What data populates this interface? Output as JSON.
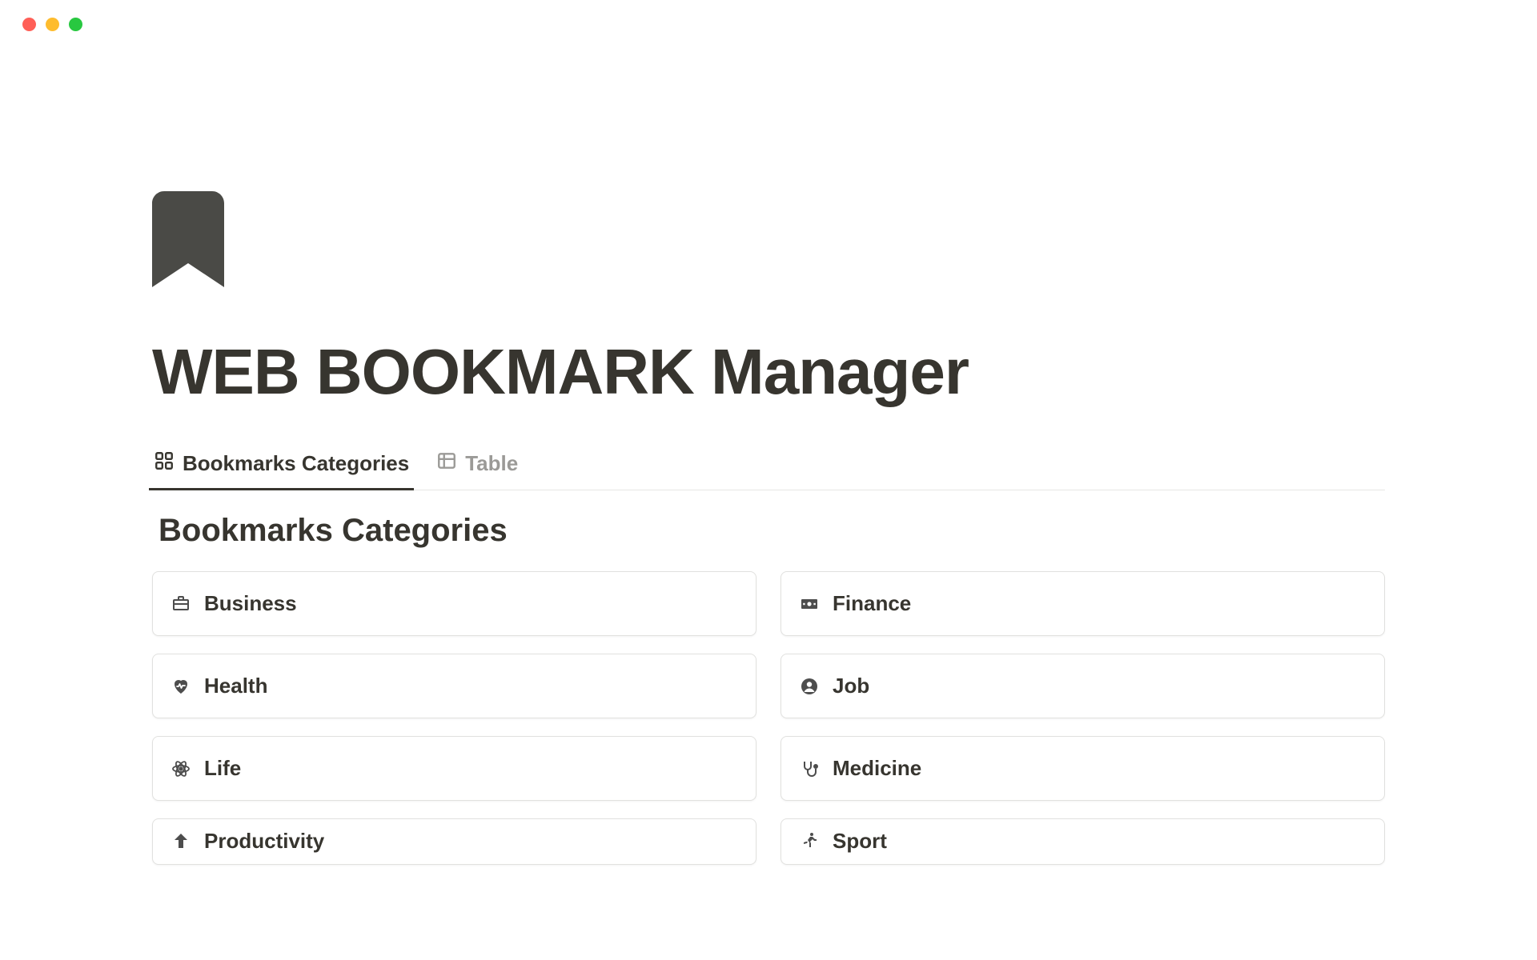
{
  "page": {
    "title": "WEB BOOKMARK Manager",
    "hero_icon": "bookmark-icon"
  },
  "tabs": [
    {
      "label": "Bookmarks Categories",
      "icon": "gallery-icon",
      "active": true
    },
    {
      "label": "Table",
      "icon": "table-icon",
      "active": false
    }
  ],
  "section": {
    "title": "Bookmarks Categories"
  },
  "categories": [
    {
      "label": "Business",
      "icon": "briefcase-icon"
    },
    {
      "label": "Finance",
      "icon": "banknote-icon"
    },
    {
      "label": "Health",
      "icon": "heartbeat-icon"
    },
    {
      "label": "Job",
      "icon": "user-circle-icon"
    },
    {
      "label": "Life",
      "icon": "atom-icon"
    },
    {
      "label": "Medicine",
      "icon": "stethoscope-icon"
    },
    {
      "label": "Productivity",
      "icon": "arrow-up-icon"
    },
    {
      "label": "Sport",
      "icon": "run-icon"
    }
  ]
}
